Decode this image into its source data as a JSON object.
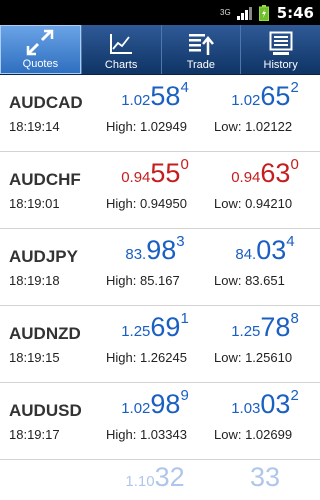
{
  "status_bar": {
    "time": "5:46",
    "network_label": "3G"
  },
  "tabs": [
    {
      "label": "Quotes",
      "icon": "quotes-icon",
      "active": true
    },
    {
      "label": "Charts",
      "icon": "charts-icon",
      "active": false
    },
    {
      "label": "Trade",
      "icon": "trade-icon",
      "active": false
    },
    {
      "label": "History",
      "icon": "history-icon",
      "active": false
    }
  ],
  "colors": {
    "up": "#1a5fc2",
    "down": "#c41e1e",
    "tab_bar": "#1f4a85",
    "tab_active": "#4a8ad6"
  },
  "quotes": [
    {
      "symbol": "AUDCAD",
      "time": "18:19:14",
      "direction": "up",
      "bid": {
        "prefix": "1.02",
        "big": "58",
        "sup": "4"
      },
      "ask": {
        "prefix": "1.02",
        "big": "65",
        "sup": "2"
      },
      "high": "High: 1.02949",
      "low": "Low: 1.02122"
    },
    {
      "symbol": "AUDCHF",
      "time": "18:19:01",
      "direction": "down",
      "bid": {
        "prefix": "0.94",
        "big": "55",
        "sup": "0"
      },
      "ask": {
        "prefix": "0.94",
        "big": "63",
        "sup": "0"
      },
      "high": "High: 0.94950",
      "low": "Low: 0.94210"
    },
    {
      "symbol": "AUDJPY",
      "time": "18:19:18",
      "direction": "up",
      "bid": {
        "prefix": "83.",
        "big": "98",
        "sup": "3"
      },
      "ask": {
        "prefix": "84.",
        "big": "03",
        "sup": "4"
      },
      "high": "High: 85.167",
      "low": "Low: 83.651"
    },
    {
      "symbol": "AUDNZD",
      "time": "18:19:15",
      "direction": "up",
      "bid": {
        "prefix": "1.25",
        "big": "69",
        "sup": "1"
      },
      "ask": {
        "prefix": "1.25",
        "big": "78",
        "sup": "8"
      },
      "high": "High: 1.26245",
      "low": "Low: 1.25610"
    },
    {
      "symbol": "AUDUSD",
      "time": "18:19:17",
      "direction": "up",
      "bid": {
        "prefix": "1.02",
        "big": "98",
        "sup": "9"
      },
      "ask": {
        "prefix": "1.03",
        "big": "03",
        "sup": "2"
      },
      "high": "High: 1.03343",
      "low": "Low: 1.02699"
    }
  ],
  "partial_row": {
    "bid": {
      "prefix": "1.10",
      "big": "32",
      "sup": ""
    },
    "ask": {
      "prefix": "",
      "big": "33",
      "sup": ""
    }
  }
}
